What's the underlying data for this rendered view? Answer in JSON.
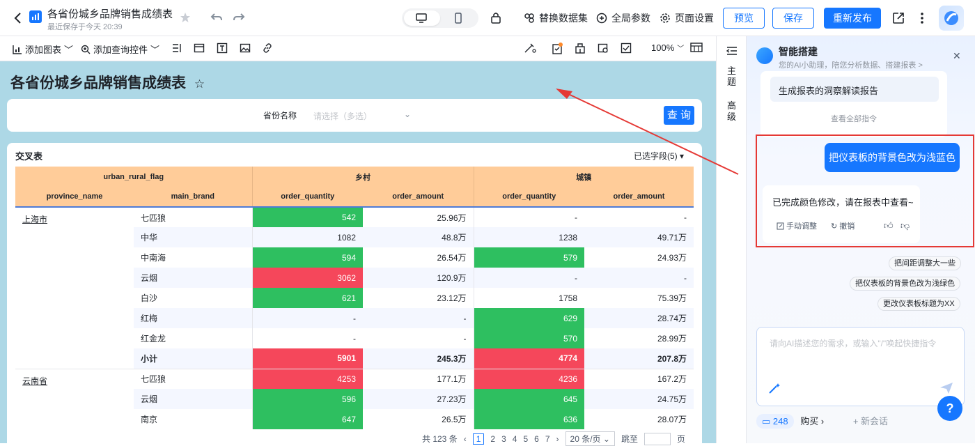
{
  "header": {
    "title": "各省份城乡品牌销售成绩表",
    "subtitle": "最近保存于今天 20:39",
    "replace_dataset": "替换数据集",
    "global_params": "全局参数",
    "page_settings": "页面设置",
    "preview": "预览",
    "save": "保存",
    "republish": "重新发布"
  },
  "toolbar": {
    "add_chart": "添加图表",
    "add_query": "添加查询控件",
    "zoom": "100%"
  },
  "dashboard": {
    "title": "各省份城乡品牌销售成绩表",
    "background_color": "#add8e6",
    "filter": {
      "label": "省份名称",
      "placeholder": "请选择（多选）",
      "query_button": "查 询"
    },
    "table": {
      "title": "交叉表",
      "fields_selected": "已选字段(5)",
      "header_group_col": "urban_rural_flag",
      "row_headers": [
        "province_name",
        "main_brand"
      ],
      "groups": [
        "乡村",
        "城镇"
      ],
      "measures": [
        "order_quantity",
        "order_amount"
      ],
      "rows": [
        {
          "province": "上海市",
          "brand": "七匹狼",
          "v": [
            "542",
            "25.96万",
            "-",
            "-"
          ],
          "c": [
            "g",
            "",
            "",
            ""
          ]
        },
        {
          "province": "",
          "brand": "中华",
          "v": [
            "1082",
            "48.8万",
            "1238",
            "49.71万"
          ],
          "c": [
            "",
            "",
            "",
            ""
          ]
        },
        {
          "province": "",
          "brand": "中南海",
          "v": [
            "594",
            "26.54万",
            "579",
            "24.93万"
          ],
          "c": [
            "g",
            "",
            "g",
            ""
          ]
        },
        {
          "province": "",
          "brand": "云烟",
          "v": [
            "3062",
            "120.9万",
            "-",
            "-"
          ],
          "c": [
            "r",
            "",
            "",
            ""
          ]
        },
        {
          "province": "",
          "brand": "白沙",
          "v": [
            "621",
            "23.12万",
            "1758",
            "75.39万"
          ],
          "c": [
            "g",
            "",
            "",
            ""
          ]
        },
        {
          "province": "",
          "brand": "红梅",
          "v": [
            "-",
            "-",
            "629",
            "28.74万"
          ],
          "c": [
            "",
            "",
            "g",
            ""
          ]
        },
        {
          "province": "",
          "brand": "红金龙",
          "v": [
            "-",
            "-",
            "570",
            "28.99万"
          ],
          "c": [
            "",
            "",
            "g",
            ""
          ]
        },
        {
          "province": "",
          "brand": "小计",
          "v": [
            "5901",
            "245.3万",
            "4774",
            "207.8万"
          ],
          "c": [
            "r",
            "",
            "r",
            ""
          ],
          "subtotal": true
        },
        {
          "province": "云南省",
          "brand": "七匹狼",
          "v": [
            "4253",
            "177.1万",
            "4236",
            "167.2万"
          ],
          "c": [
            "r",
            "",
            "r",
            ""
          ]
        },
        {
          "province": "",
          "brand": "云烟",
          "v": [
            "596",
            "27.23万",
            "645",
            "24.75万"
          ],
          "c": [
            "g",
            "",
            "g",
            ""
          ]
        },
        {
          "province": "",
          "brand": "南京",
          "v": [
            "647",
            "26.5万",
            "636",
            "28.07万"
          ],
          "c": [
            "g",
            "",
            "g",
            ""
          ]
        }
      ]
    },
    "pagination": {
      "total": "共 123 条",
      "pages": [
        "1",
        "2",
        "3",
        "4",
        "5",
        "6",
        "7"
      ],
      "page_size": "20 条/页",
      "jump_label": "跳至",
      "page_unit": "页"
    }
  },
  "side_tabs": [
    "主题",
    "高级"
  ],
  "ai_panel": {
    "title": "智能搭建",
    "subtitle": "您的AI小助理，陪您分析数据、搭建报表 >",
    "command": "生成报表的洞察解读报告",
    "view_all": "查看全部指令",
    "user_message": "把仪表板的背景色改为浅蓝色",
    "bot_message": "已完成颜色修改，请在报表中查看~",
    "manual_adjust": "手动调整",
    "undo": "撤销",
    "suggestions": [
      "把间距调整大一些",
      "把仪表板的背景色改为浅绿色",
      "更改仪表板标题为XX"
    ],
    "input_placeholder": "请向AI描述您的需求，或输入\"/\"唤起快捷指令",
    "credits": "248",
    "buy": "购买",
    "new_chat": "+ 新会话",
    "help": "?"
  },
  "colors": {
    "accent": "#1677ff",
    "header_fill": "#ffcc99",
    "good": "#2ebf60",
    "bad": "#f5475b",
    "annotation": "#e53935"
  }
}
